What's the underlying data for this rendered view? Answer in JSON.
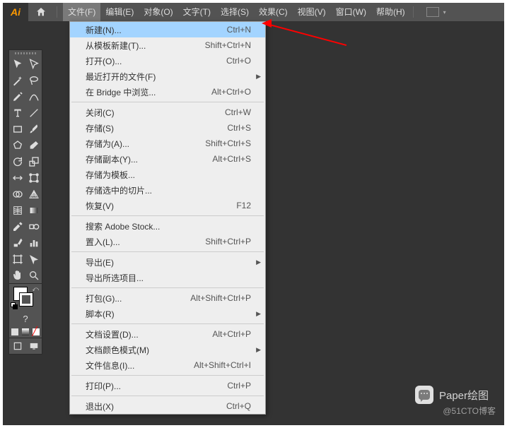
{
  "app": {
    "logo": "Ai"
  },
  "menubar": {
    "items": [
      {
        "label": "文件(F)",
        "active": true
      },
      {
        "label": "编辑(E)"
      },
      {
        "label": "对象(O)"
      },
      {
        "label": "文字(T)"
      },
      {
        "label": "选择(S)"
      },
      {
        "label": "效果(C)"
      },
      {
        "label": "视图(V)"
      },
      {
        "label": "窗口(W)"
      },
      {
        "label": "帮助(H)"
      }
    ]
  },
  "dropdown": [
    {
      "type": "item",
      "label": "新建(N)...",
      "shortcut": "Ctrl+N",
      "highlight": true
    },
    {
      "type": "item",
      "label": "从模板新建(T)...",
      "shortcut": "Shift+Ctrl+N"
    },
    {
      "type": "item",
      "label": "打开(O)...",
      "shortcut": "Ctrl+O"
    },
    {
      "type": "item",
      "label": "最近打开的文件(F)",
      "submenu": true
    },
    {
      "type": "item",
      "label": "在 Bridge 中浏览...",
      "shortcut": "Alt+Ctrl+O"
    },
    {
      "type": "sep"
    },
    {
      "type": "item",
      "label": "关闭(C)",
      "shortcut": "Ctrl+W"
    },
    {
      "type": "item",
      "label": "存储(S)",
      "shortcut": "Ctrl+S"
    },
    {
      "type": "item",
      "label": "存储为(A)...",
      "shortcut": "Shift+Ctrl+S"
    },
    {
      "type": "item",
      "label": "存储副本(Y)...",
      "shortcut": "Alt+Ctrl+S"
    },
    {
      "type": "item",
      "label": "存储为模板..."
    },
    {
      "type": "item",
      "label": "存储选中的切片..."
    },
    {
      "type": "item",
      "label": "恢复(V)",
      "shortcut": "F12"
    },
    {
      "type": "sep"
    },
    {
      "type": "item",
      "label": "搜索 Adobe Stock..."
    },
    {
      "type": "item",
      "label": "置入(L)...",
      "shortcut": "Shift+Ctrl+P"
    },
    {
      "type": "sep"
    },
    {
      "type": "item",
      "label": "导出(E)",
      "submenu": true
    },
    {
      "type": "item",
      "label": "导出所选项目..."
    },
    {
      "type": "sep"
    },
    {
      "type": "item",
      "label": "打包(G)...",
      "shortcut": "Alt+Shift+Ctrl+P"
    },
    {
      "type": "item",
      "label": "脚本(R)",
      "submenu": true
    },
    {
      "type": "sep"
    },
    {
      "type": "item",
      "label": "文档设置(D)...",
      "shortcut": "Alt+Ctrl+P"
    },
    {
      "type": "item",
      "label": "文档颜色模式(M)",
      "submenu": true
    },
    {
      "type": "item",
      "label": "文件信息(I)...",
      "shortcut": "Alt+Shift+Ctrl+I"
    },
    {
      "type": "sep"
    },
    {
      "type": "item",
      "label": "打印(P)...",
      "shortcut": "Ctrl+P"
    },
    {
      "type": "sep"
    },
    {
      "type": "item",
      "label": "退出(X)",
      "shortcut": "Ctrl+Q"
    }
  ],
  "quickmode": {
    "label": "?"
  },
  "watermark": {
    "text": "Paper绘图",
    "sub": "@51CTO博客"
  }
}
